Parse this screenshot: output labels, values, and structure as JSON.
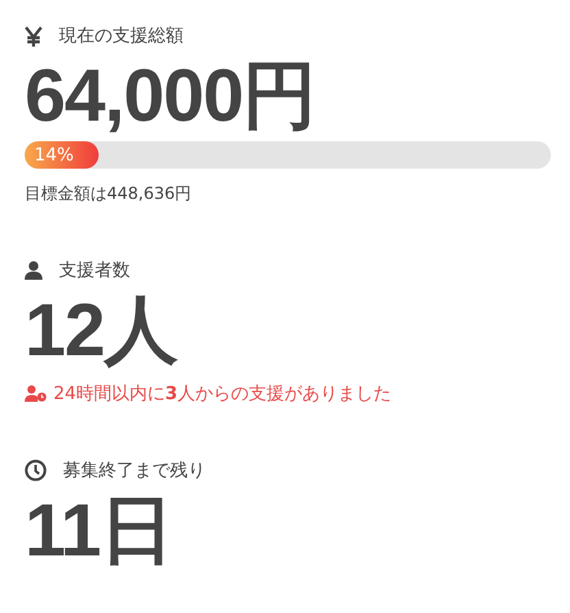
{
  "sections": [
    {
      "kind": "money",
      "label": "現在の支援総額",
      "value": "64,000円",
      "progress": {
        "level": 0.14,
        "text": "14%"
      },
      "note": "目標金額は448,636円"
    },
    {
      "kind": "people",
      "label": "支援者数",
      "value": "12人",
      "alert": "24時間以内に**3**人からの支援がありました"
    },
    {
      "kind": "time",
      "label": "募集終了まで残り",
      "value": "11日"
    }
  ]
}
